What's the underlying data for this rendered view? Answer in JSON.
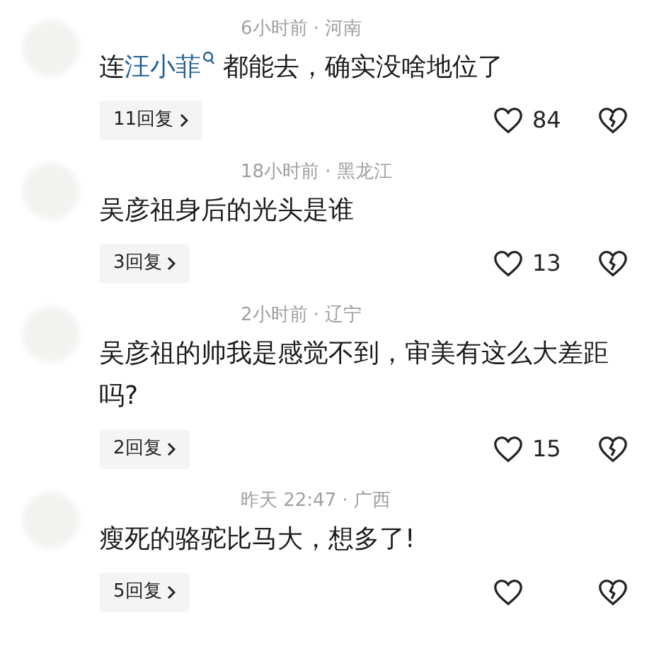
{
  "comments": [
    {
      "meta": "6小时前 · 河南",
      "content": [
        {
          "kind": "text",
          "text": "连"
        },
        {
          "kind": "search-link",
          "text": "汪小菲"
        },
        {
          "kind": "text",
          "text": " 都能去，确实没啥地位了"
        }
      ],
      "replies": "11回复",
      "likes": "84"
    },
    {
      "meta": "18小时前 · 黑龙江",
      "content": [
        {
          "kind": "text",
          "text": "吴彦祖身后的光头是谁"
        }
      ],
      "replies": "3回复",
      "likes": "13"
    },
    {
      "meta": "2小时前 · 辽宁",
      "content": [
        {
          "kind": "text",
          "text": "吴彦祖的帅我是感觉不到，审美有这么大差距吗?"
        }
      ],
      "replies": "2回复",
      "likes": "15"
    },
    {
      "meta": "昨天 22:47 · 广西",
      "content": [
        {
          "kind": "text",
          "text": "瘦死的骆驼比马大，想多了!"
        }
      ],
      "replies": "5回复"
    }
  ]
}
